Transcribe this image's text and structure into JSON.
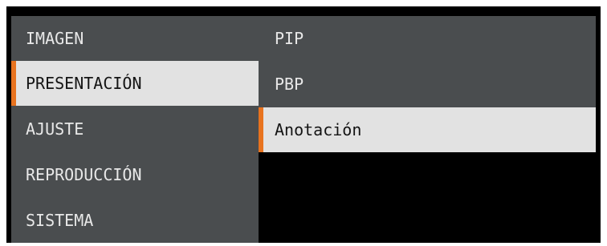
{
  "menu": {
    "categories": [
      {
        "label": "IMAGEN"
      },
      {
        "label": "PRESENTACIÓN"
      },
      {
        "label": "AJUSTE"
      },
      {
        "label": "REPRODUCCIÓN"
      },
      {
        "label": "SISTEMA"
      }
    ],
    "selected_category": "PRESENTACIÓN",
    "submenu": [
      {
        "label": "PIP"
      },
      {
        "label": "PBP"
      },
      {
        "label": "Anotación"
      }
    ],
    "selected_submenu": "Anotación"
  },
  "colors": {
    "panel": "#4a4d4f",
    "highlight": "#e2e2e2",
    "accent": "#e8731f",
    "background": "#000000"
  }
}
